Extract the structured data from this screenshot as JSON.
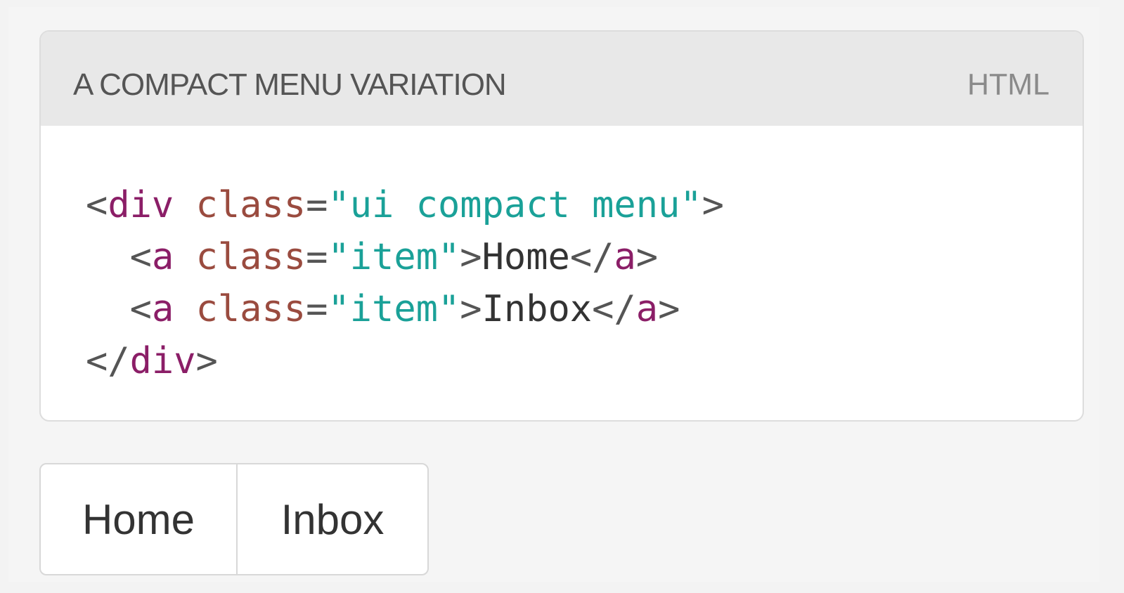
{
  "code_example": {
    "title": "A COMPACT MENU VARIATION",
    "language": "HTML",
    "lines": [
      [
        {
          "kind": "punct",
          "text": "<"
        },
        {
          "kind": "tag",
          "text": "div"
        },
        {
          "kind": "text",
          "text": " "
        },
        {
          "kind": "attr",
          "text": "class"
        },
        {
          "kind": "punct",
          "text": "="
        },
        {
          "kind": "value",
          "text": "\"ui compact menu\""
        },
        {
          "kind": "punct",
          "text": ">"
        }
      ],
      [
        {
          "kind": "text",
          "text": "  "
        },
        {
          "kind": "punct",
          "text": "<"
        },
        {
          "kind": "tag",
          "text": "a"
        },
        {
          "kind": "text",
          "text": " "
        },
        {
          "kind": "attr",
          "text": "class"
        },
        {
          "kind": "punct",
          "text": "="
        },
        {
          "kind": "value",
          "text": "\"item\""
        },
        {
          "kind": "punct",
          "text": ">"
        },
        {
          "kind": "text",
          "text": "Home"
        },
        {
          "kind": "punct",
          "text": "</"
        },
        {
          "kind": "tag",
          "text": "a"
        },
        {
          "kind": "punct",
          "text": ">"
        }
      ],
      [
        {
          "kind": "text",
          "text": "  "
        },
        {
          "kind": "punct",
          "text": "<"
        },
        {
          "kind": "tag",
          "text": "a"
        },
        {
          "kind": "text",
          "text": " "
        },
        {
          "kind": "attr",
          "text": "class"
        },
        {
          "kind": "punct",
          "text": "="
        },
        {
          "kind": "value",
          "text": "\"item\""
        },
        {
          "kind": "punct",
          "text": ">"
        },
        {
          "kind": "text",
          "text": "Inbox"
        },
        {
          "kind": "punct",
          "text": "</"
        },
        {
          "kind": "tag",
          "text": "a"
        },
        {
          "kind": "punct",
          "text": ">"
        }
      ],
      [
        {
          "kind": "punct",
          "text": "</"
        },
        {
          "kind": "tag",
          "text": "div"
        },
        {
          "kind": "punct",
          "text": ">"
        }
      ]
    ]
  },
  "compact_menu": {
    "items": [
      {
        "label": "Home"
      },
      {
        "label": "Inbox"
      }
    ]
  },
  "colors": {
    "tag": "#8b1e67",
    "attribute": "#9a4b3f",
    "value": "#1aa198",
    "header_background": "#e8e8e8",
    "border": "#d8d8d8"
  }
}
